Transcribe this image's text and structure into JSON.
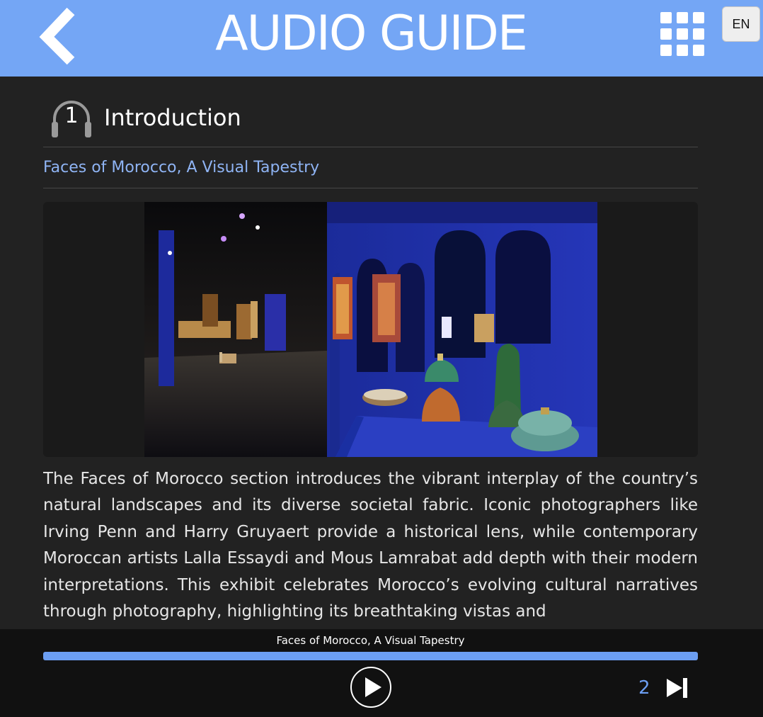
{
  "header": {
    "title": "AUDIO GUIDE",
    "back_icon": "chevron-left-icon",
    "grid_icon": "grid-icon",
    "language": "EN",
    "background_color": "#74a6f5"
  },
  "stop": {
    "number": "1",
    "title": "Introduction",
    "icon": "headphones-icon",
    "subtitle": "Faces of Morocco, A Visual Tapestry",
    "image_description_icon": "gallery-photo",
    "description": "The Faces of Morocco section introduces the vibrant interplay of the country’s natural landscapes and its diverse societal fabric. Iconic photographers like Irving Penn and Harry Gruyaert provide a historical lens, while contemporary Moroccan artists Lalla Essaydi and Mous Lamrabat add depth with their modern interpretations. This exhibit celebrates Morocco’s evolving cultural narratives through photography, highlighting its breathtaking vistas and"
  },
  "player": {
    "track_title": "Faces of Morocco, A Visual Tapestry",
    "progress": 1.0,
    "play_icon": "play-icon",
    "next_number": "2",
    "next_icon": "skip-next-icon",
    "accent_color": "#6c9ef2"
  }
}
